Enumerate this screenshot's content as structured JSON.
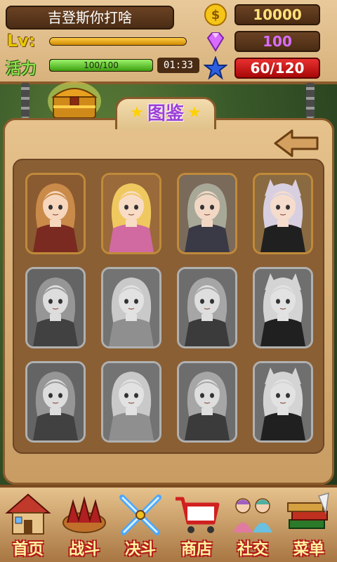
{
  "player": {
    "name": "吉登斯你打啥",
    "level_label": "Lv:",
    "level_progress": 1.0,
    "vitality_label": "活力",
    "vitality_text": "100/100",
    "vitality_progress": 1.0,
    "timer": "01:33"
  },
  "resources": {
    "coins": "10000",
    "gems": "100",
    "stars": "60/120"
  },
  "panel": {
    "title": "图鉴"
  },
  "collection": {
    "cards": [
      {
        "character": "girl-1",
        "unlocked": true
      },
      {
        "character": "girl-2",
        "unlocked": true
      },
      {
        "character": "girl-3",
        "unlocked": true
      },
      {
        "character": "girl-4",
        "unlocked": true
      },
      {
        "character": "girl-1",
        "unlocked": false
      },
      {
        "character": "girl-2",
        "unlocked": false
      },
      {
        "character": "girl-3",
        "unlocked": false
      },
      {
        "character": "girl-4",
        "unlocked": false
      },
      {
        "character": "girl-1",
        "unlocked": false
      },
      {
        "character": "girl-2",
        "unlocked": false
      },
      {
        "character": "girl-3",
        "unlocked": false
      },
      {
        "character": "girl-4",
        "unlocked": false
      }
    ]
  },
  "nav": {
    "items": [
      {
        "label": "首页",
        "icon": "house-icon"
      },
      {
        "label": "战斗",
        "icon": "battle-icon"
      },
      {
        "label": "决斗",
        "icon": "crossed-swords-icon"
      },
      {
        "label": "商店",
        "icon": "cart-icon"
      },
      {
        "label": "社交",
        "icon": "friends-icon"
      },
      {
        "label": "菜单",
        "icon": "books-icon"
      }
    ]
  },
  "colors": {
    "wood": "#d8b27c",
    "gold_card_border": "#c08a3a",
    "gray_card_border": "#b0b0b0",
    "title_purple": "#9b3fd6",
    "nav_label_outline": "#b41c1c"
  }
}
